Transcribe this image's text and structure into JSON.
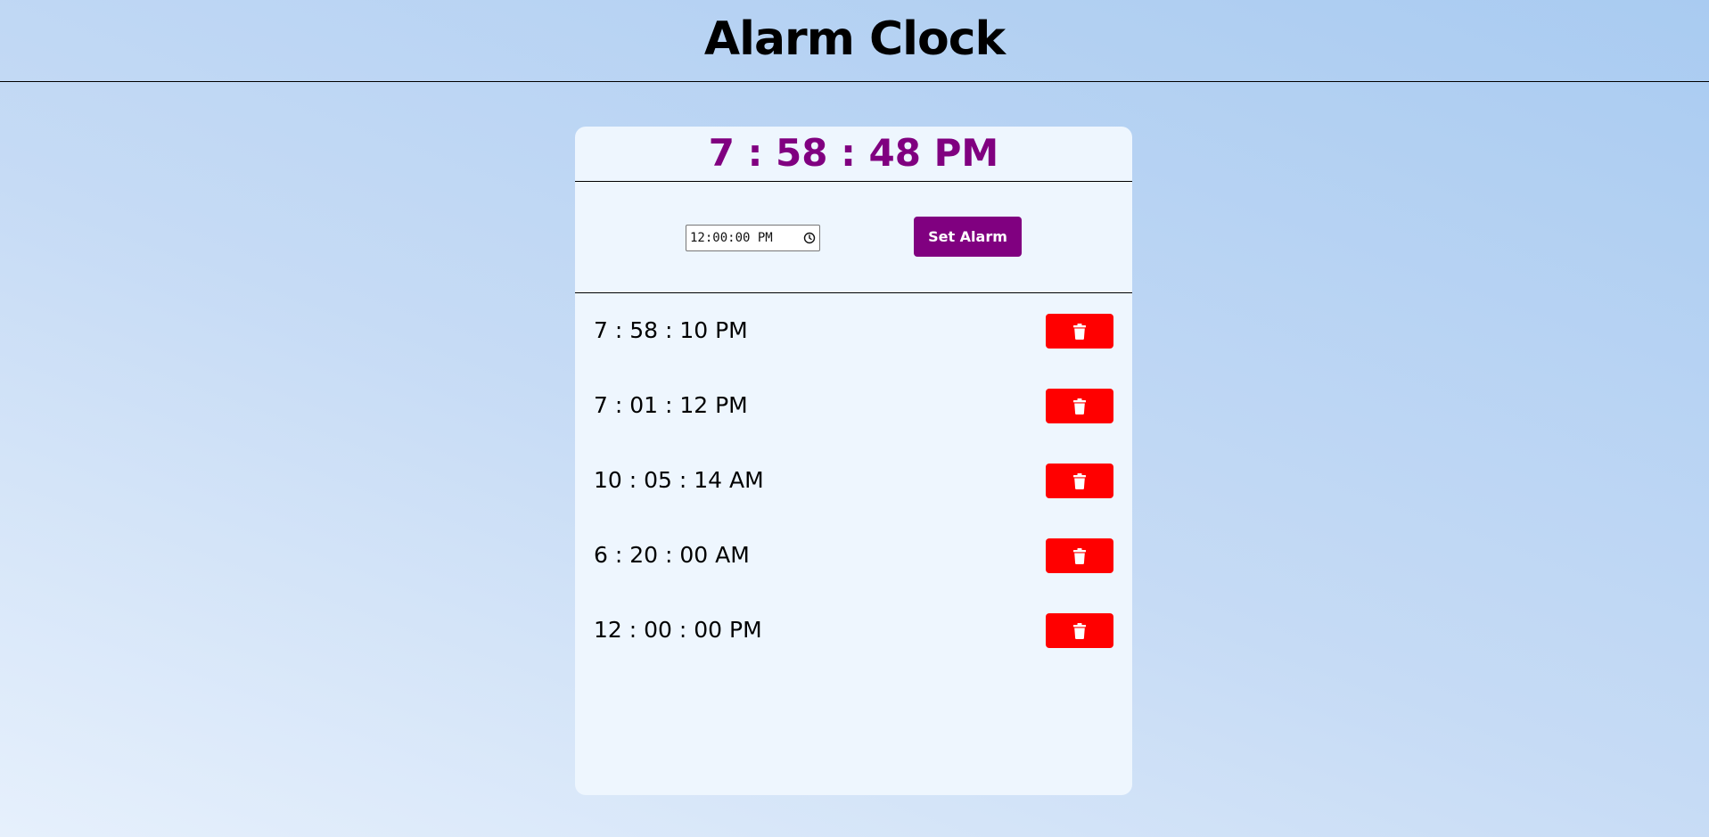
{
  "header": {
    "title": "Alarm Clock"
  },
  "clock": {
    "current_time": "7 : 58 : 48 PM"
  },
  "controls": {
    "time_input_value": "12:00:00 PM",
    "time_input_icon": "clock-icon",
    "set_alarm_label": "Set Alarm"
  },
  "alarms": [
    {
      "time": "7 : 58 : 10 PM",
      "delete_icon": "trash-icon"
    },
    {
      "time": "7 : 01 : 12 PM",
      "delete_icon": "trash-icon"
    },
    {
      "time": "10 : 05 : 14 AM",
      "delete_icon": "trash-icon"
    },
    {
      "time": "6 : 20 : 00 AM",
      "delete_icon": "trash-icon"
    },
    {
      "time": "12 : 00 : 00 PM",
      "delete_icon": "trash-icon"
    }
  ],
  "colors": {
    "accent": "#800080",
    "delete": "#ff0000",
    "card_background": "#eef6fe"
  }
}
